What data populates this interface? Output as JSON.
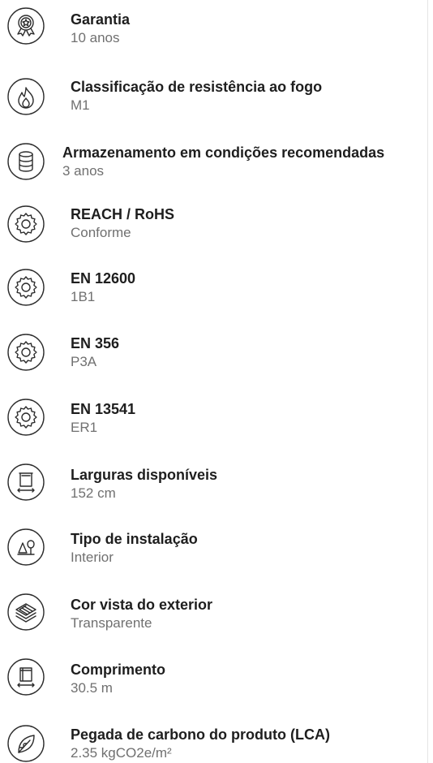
{
  "specs": [
    {
      "label": "Garantia",
      "value": "10 anos",
      "icon": "warranty-badge-icon"
    },
    {
      "label": "Classificação de resistência ao fogo",
      "value": "M1",
      "icon": "flame-icon"
    },
    {
      "label": "Armazenamento em condições recomendadas",
      "value": "3 anos",
      "icon": "storage-database-icon"
    },
    {
      "label": "REACH / RoHS",
      "value": "Conforme",
      "icon": "gear-icon"
    },
    {
      "label": "EN 12600",
      "value": "1B1",
      "icon": "gear-icon"
    },
    {
      "label": "EN 356",
      "value": "P3A",
      "icon": "gear-icon"
    },
    {
      "label": "EN 13541",
      "value": "ER1",
      "icon": "gear-icon"
    },
    {
      "label": "Larguras disponíveis",
      "value": "152 cm",
      "icon": "roll-width-icon"
    },
    {
      "label": "Tipo de instalação",
      "value": "Interior",
      "icon": "indoor-tree-icon"
    },
    {
      "label": "Cor vista do exterior",
      "value": "Transparente",
      "icon": "layers-icon"
    },
    {
      "label": "Comprimento",
      "value": "30.5 m",
      "icon": "roll-length-icon"
    },
    {
      "label": "Pegada de carbono do produto (LCA)",
      "value": "2.35 kgCO2e/m²",
      "icon": "leaf-icon"
    }
  ]
}
